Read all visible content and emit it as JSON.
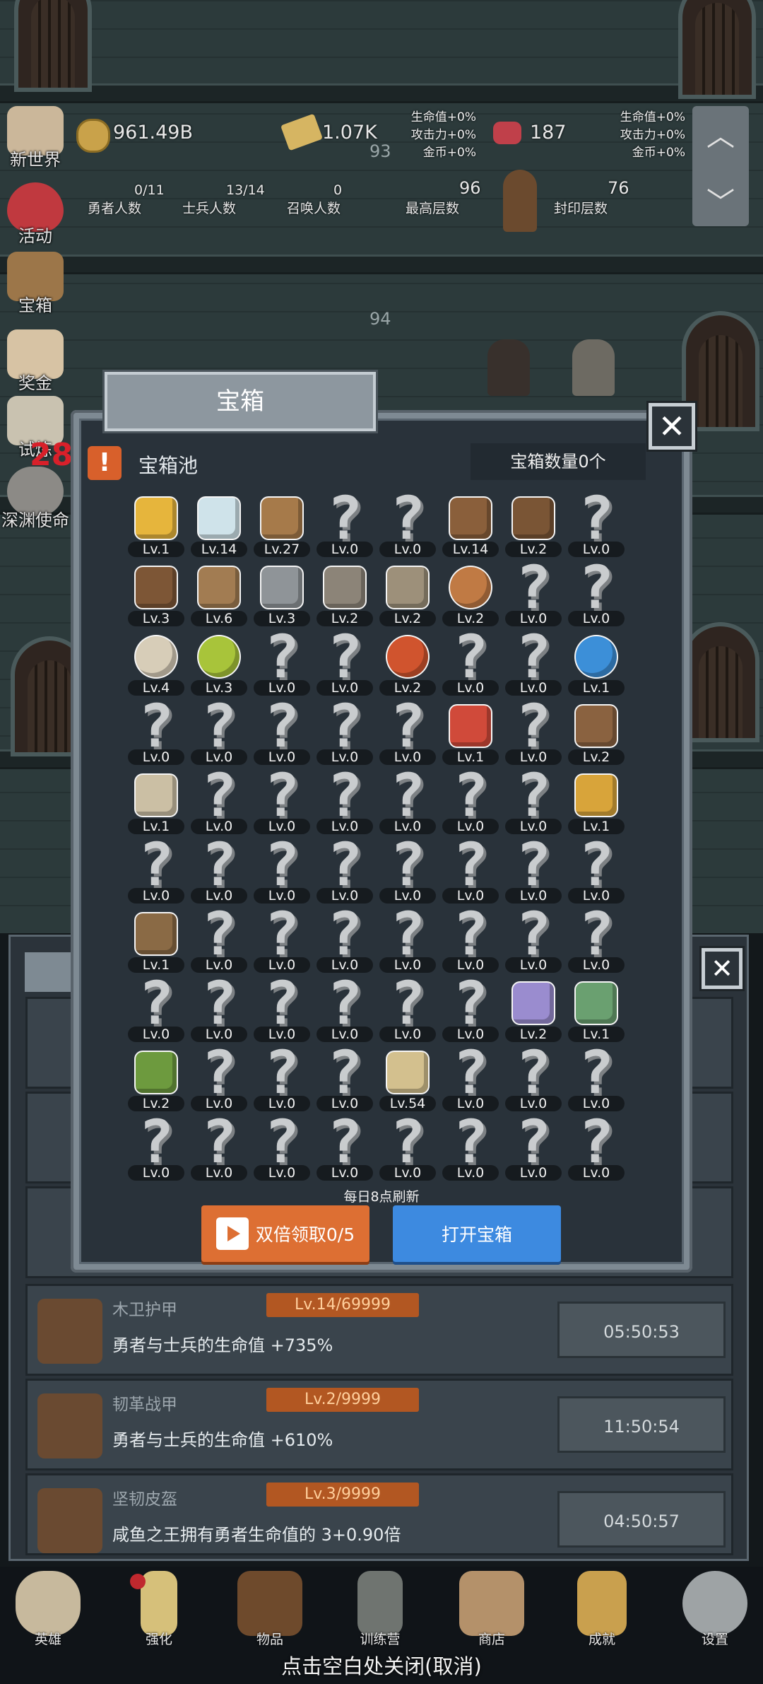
{
  "top": {
    "gold": "961.49B",
    "bar": "1.07K",
    "gem": "187",
    "buff_left": [
      "生命值+0%",
      "攻击力+0%",
      "金币+0%"
    ],
    "buff_right": [
      "生命值+0%",
      "攻击力+0%",
      "金币+0%"
    ],
    "stats": [
      {
        "value": "0/11",
        "label": "勇者人数"
      },
      {
        "value": "13/14",
        "label": "士兵人数"
      },
      {
        "value": "0",
        "label": "召唤人数"
      },
      {
        "value": "96",
        "label": "最高层数"
      },
      {
        "value": "76",
        "label": "封印层数"
      }
    ],
    "floor_93": "93",
    "floor_94": "94",
    "counter_28": "28"
  },
  "side_menu": [
    "新世界",
    "活动",
    "宝箱",
    "奖金",
    "试炼",
    "深渊使命"
  ],
  "modal": {
    "title": "宝箱",
    "close": "✕",
    "pool_label": "宝箱池",
    "count_label": "宝箱数量0个",
    "refresh_note": "每日8点刷新",
    "double_button": "双倍领取0/5",
    "open_button": "打开宝箱",
    "cells": [
      {
        "icon": "crown",
        "lv": "Lv.1"
      },
      {
        "icon": "diamond",
        "lv": "Lv.14"
      },
      {
        "icon": "wood-sword",
        "lv": "Lv.27"
      },
      {
        "icon": "unknown",
        "lv": "Lv.0"
      },
      {
        "icon": "unknown",
        "lv": "Lv.0"
      },
      {
        "icon": "wood-armor",
        "lv": "Lv.14"
      },
      {
        "icon": "leather-armor",
        "lv": "Lv.2"
      },
      {
        "icon": "unknown",
        "lv": "Lv.0"
      },
      {
        "icon": "leather-helmet",
        "lv": "Lv.3"
      },
      {
        "icon": "dagger",
        "lv": "Lv.6"
      },
      {
        "icon": "knight-helmet",
        "lv": "Lv.3"
      },
      {
        "icon": "hammer",
        "lv": "Lv.2"
      },
      {
        "icon": "iron-helmet",
        "lv": "Lv.2"
      },
      {
        "icon": "meat",
        "lv": "Lv.2"
      },
      {
        "icon": "unknown",
        "lv": "Lv.0"
      },
      {
        "icon": "unknown",
        "lv": "Lv.0"
      },
      {
        "icon": "bun",
        "lv": "Lv.4"
      },
      {
        "icon": "green-potion",
        "lv": "Lv.3"
      },
      {
        "icon": "unknown",
        "lv": "Lv.0"
      },
      {
        "icon": "unknown",
        "lv": "Lv.0"
      },
      {
        "icon": "red-potion",
        "lv": "Lv.2"
      },
      {
        "icon": "unknown",
        "lv": "Lv.0"
      },
      {
        "icon": "unknown",
        "lv": "Lv.0"
      },
      {
        "icon": "blue-potion",
        "lv": "Lv.1"
      },
      {
        "icon": "unknown",
        "lv": "Lv.0"
      },
      {
        "icon": "unknown",
        "lv": "Lv.0"
      },
      {
        "icon": "unknown",
        "lv": "Lv.0"
      },
      {
        "icon": "unknown",
        "lv": "Lv.0"
      },
      {
        "icon": "unknown",
        "lv": "Lv.0"
      },
      {
        "icon": "red-flask",
        "lv": "Lv.1"
      },
      {
        "icon": "unknown",
        "lv": "Lv.0"
      },
      {
        "icon": "boot",
        "lv": "Lv.2"
      },
      {
        "icon": "shoe",
        "lv": "Lv.1"
      },
      {
        "icon": "unknown",
        "lv": "Lv.0"
      },
      {
        "icon": "unknown",
        "lv": "Lv.0"
      },
      {
        "icon": "unknown",
        "lv": "Lv.0"
      },
      {
        "icon": "unknown",
        "lv": "Lv.0"
      },
      {
        "icon": "unknown",
        "lv": "Lv.0"
      },
      {
        "icon": "unknown",
        "lv": "Lv.0"
      },
      {
        "icon": "torch-staff",
        "lv": "Lv.1"
      },
      {
        "icon": "unknown",
        "lv": "Lv.0"
      },
      {
        "icon": "unknown",
        "lv": "Lv.0"
      },
      {
        "icon": "unknown",
        "lv": "Lv.0"
      },
      {
        "icon": "unknown",
        "lv": "Lv.0"
      },
      {
        "icon": "unknown",
        "lv": "Lv.0"
      },
      {
        "icon": "unknown",
        "lv": "Lv.0"
      },
      {
        "icon": "unknown",
        "lv": "Lv.0"
      },
      {
        "icon": "unknown",
        "lv": "Lv.0"
      },
      {
        "icon": "backpack",
        "lv": "Lv.1"
      },
      {
        "icon": "unknown",
        "lv": "Lv.0"
      },
      {
        "icon": "unknown",
        "lv": "Lv.0"
      },
      {
        "icon": "unknown",
        "lv": "Lv.0"
      },
      {
        "icon": "unknown",
        "lv": "Lv.0"
      },
      {
        "icon": "unknown",
        "lv": "Lv.0"
      },
      {
        "icon": "unknown",
        "lv": "Lv.0"
      },
      {
        "icon": "unknown",
        "lv": "Lv.0"
      },
      {
        "icon": "unknown",
        "lv": "Lv.0"
      },
      {
        "icon": "unknown",
        "lv": "Lv.0"
      },
      {
        "icon": "unknown",
        "lv": "Lv.0"
      },
      {
        "icon": "unknown",
        "lv": "Lv.0"
      },
      {
        "icon": "unknown",
        "lv": "Lv.0"
      },
      {
        "icon": "unknown",
        "lv": "Lv.0"
      },
      {
        "icon": "octopus",
        "lv": "Lv.2"
      },
      {
        "icon": "amulet",
        "lv": "Lv.1"
      },
      {
        "icon": "gem-scepter",
        "lv": "Lv.2"
      },
      {
        "icon": "unknown",
        "lv": "Lv.0"
      },
      {
        "icon": "unknown",
        "lv": "Lv.0"
      },
      {
        "icon": "unknown",
        "lv": "Lv.0"
      },
      {
        "icon": "beer-mug",
        "lv": "Lv.54"
      },
      {
        "icon": "unknown",
        "lv": "Lv.0"
      },
      {
        "icon": "unknown",
        "lv": "Lv.0"
      },
      {
        "icon": "unknown",
        "lv": "Lv.0"
      },
      {
        "icon": "unknown",
        "lv": "Lv.0"
      },
      {
        "icon": "unknown",
        "lv": "Lv.0"
      },
      {
        "icon": "unknown",
        "lv": "Lv.0"
      },
      {
        "icon": "unknown",
        "lv": "Lv.0"
      },
      {
        "icon": "unknown",
        "lv": "Lv.0"
      },
      {
        "icon": "unknown",
        "lv": "Lv.0"
      },
      {
        "icon": "unknown",
        "lv": "Lv.0"
      },
      {
        "icon": "unknown",
        "lv": "Lv.0"
      }
    ]
  },
  "list": {
    "close": "✕",
    "rows": [
      {
        "name": "木卫护甲",
        "level": "Lv.14/69999",
        "desc": "勇者与士兵的生命值 +735%",
        "time": "05:50:53"
      },
      {
        "name": "韧革战甲",
        "level": "Lv.2/9999",
        "desc": "勇者与士兵的生命值 +610%",
        "time": "11:50:54"
      },
      {
        "name": "坚韧皮盔",
        "level": "Lv.3/9999",
        "desc": "咸鱼之王拥有勇者生命值的 3+0.90倍",
        "time": "04:50:57"
      }
    ]
  },
  "nav": [
    "英雄",
    "强化",
    "物品",
    "训练营",
    "商店",
    "成就",
    "设置"
  ],
  "close_hint": "点击空白处关闭(取消)",
  "colors": {
    "orange_button": "#dd6f33",
    "blue_button": "#3d8ae0",
    "level_badge": "#b25722",
    "warning": "#d8602b"
  }
}
